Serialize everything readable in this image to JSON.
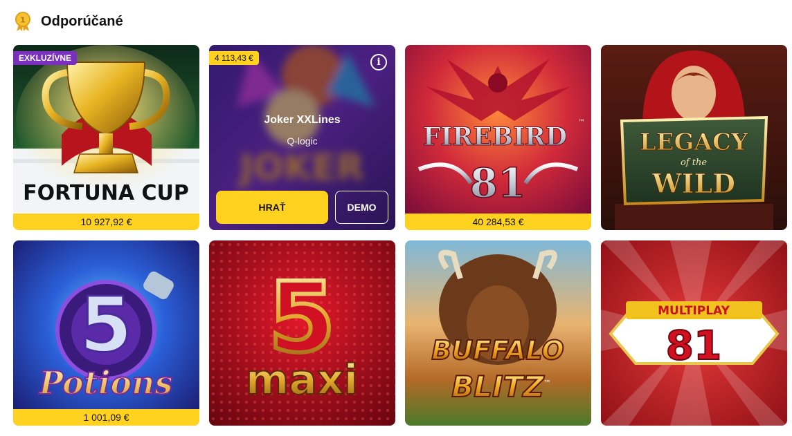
{
  "section": {
    "title": "Odporúčané",
    "icon": "medal-icon"
  },
  "colors": {
    "accent_yellow": "#ffd21f",
    "badge_purple": "#7b2fbe"
  },
  "games": [
    {
      "logo": "FORTUNA CUP",
      "badge": "EXKLUZÍVNE",
      "jackpot": "10 927,92  €"
    },
    {
      "name": "Joker XXLines",
      "provider": "Q-logic",
      "logo": "JOKER",
      "jackpot_badge": "4 113,43 €",
      "play_label": "HRAŤ",
      "demo_label": "DEMO",
      "info_icon": "info-icon"
    },
    {
      "logo_line1": "FIREBIRD",
      "logo_line2": "81",
      "tm": "™",
      "jackpot": "40 284,53  €"
    },
    {
      "logo_line1": "LEGACY",
      "logo_line2": "of the",
      "logo_line3": "WILD"
    },
    {
      "logo_line1": "5",
      "logo_line2": "Potions",
      "jackpot": "1 001,09  €"
    },
    {
      "logo_line1": "5",
      "logo_line2": "maxi"
    },
    {
      "logo_line1": "BUFFALO",
      "logo_line2": "BLITZ",
      "tm": "™"
    },
    {
      "logo_line1": "MULTIPLAY",
      "logo_line2": "81"
    }
  ]
}
